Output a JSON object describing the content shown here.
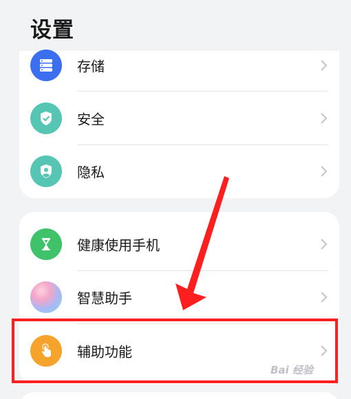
{
  "header": {
    "title": "设置"
  },
  "groups": [
    {
      "items": [
        {
          "label": "存储",
          "icon": "storage-icon",
          "color": "#3b6ff0"
        },
        {
          "label": "安全",
          "icon": "shield-check-icon",
          "color": "#56c5b4"
        },
        {
          "label": "隐私",
          "icon": "privacy-shield-icon",
          "color": "#56c5b4"
        }
      ]
    },
    {
      "items": [
        {
          "label": "健康使用手机",
          "icon": "hourglass-icon",
          "color": "#3fc26a"
        },
        {
          "label": "智慧助手",
          "icon": "assistant-orb-icon",
          "color": "#c9a4e8"
        },
        {
          "label": "辅助功能",
          "icon": "hand-tap-icon",
          "color": "#f6a32c"
        }
      ]
    }
  ],
  "annotation": {
    "highlight_color": "#ff1f1f"
  },
  "watermark": {
    "text": "Bai 经验"
  }
}
